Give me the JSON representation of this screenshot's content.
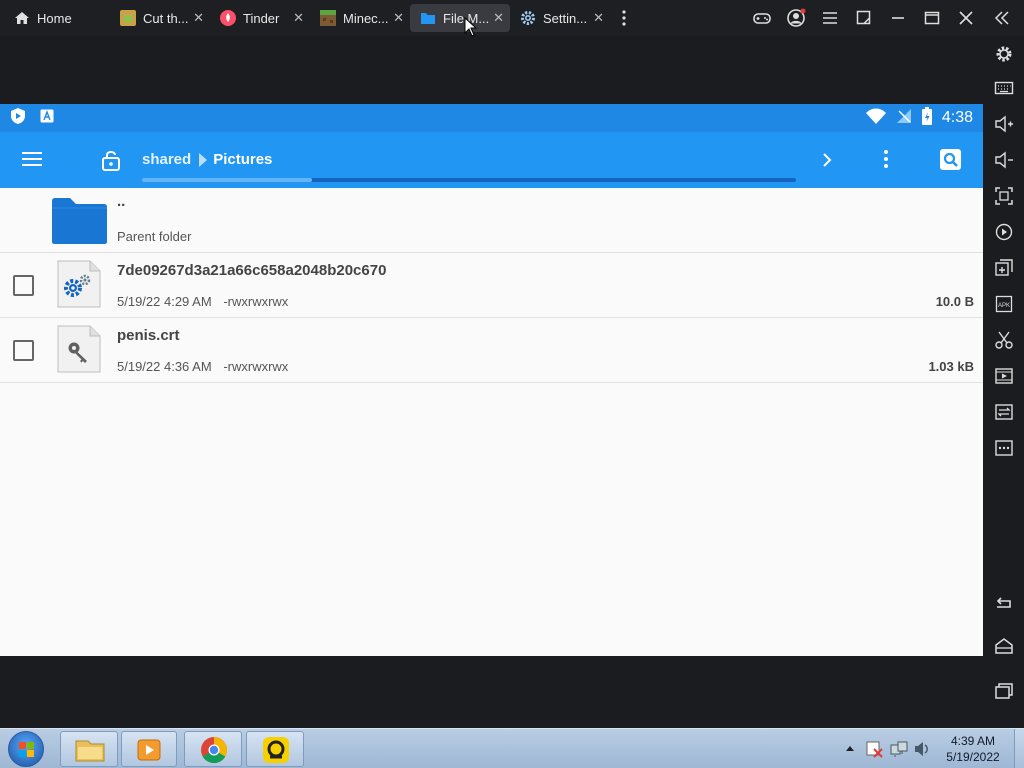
{
  "tabs": [
    {
      "label": "Home",
      "icon": "home-icon",
      "closable": false
    },
    {
      "label": "Cut th...",
      "icon": "cut-the-rope-app-icon",
      "closable": true
    },
    {
      "label": "Tinder",
      "icon": "tinder-app-icon",
      "closable": true
    },
    {
      "label": "Minec...",
      "icon": "minecraft-app-icon",
      "closable": true
    },
    {
      "label": "File M...",
      "icon": "file-manager-app-icon",
      "closable": true,
      "active": true
    },
    {
      "label": "Settin...",
      "icon": "settings-app-icon",
      "closable": true
    }
  ],
  "tab_close_glyph": "✕",
  "statusbar": {
    "time": "4:38"
  },
  "appbar": {
    "breadcrumbs": [
      "shared",
      "Pictures"
    ],
    "progress": 0.26
  },
  "files": {
    "parent": {
      "name": "..",
      "subtitle": "Parent folder"
    },
    "items": [
      {
        "name": "7de09267d3a21a66c658a2048b20c670",
        "date": "5/19/22 4:29 AM",
        "perms": "-rwxrwxrwx",
        "size": "10.0 B",
        "icon": "gear-file-icon"
      },
      {
        "name": "penis.crt",
        "date": "5/19/22 4:36 AM",
        "perms": "-rwxrwxrwx",
        "size": "1.03 kB",
        "icon": "key-file-icon"
      }
    ]
  },
  "taskbar": {
    "time": "4:39 AM",
    "date": "5/19/2022"
  },
  "colors": {
    "primary": "#2196f3",
    "statusbar": "#1f88e5",
    "folder": "#1976d2"
  }
}
